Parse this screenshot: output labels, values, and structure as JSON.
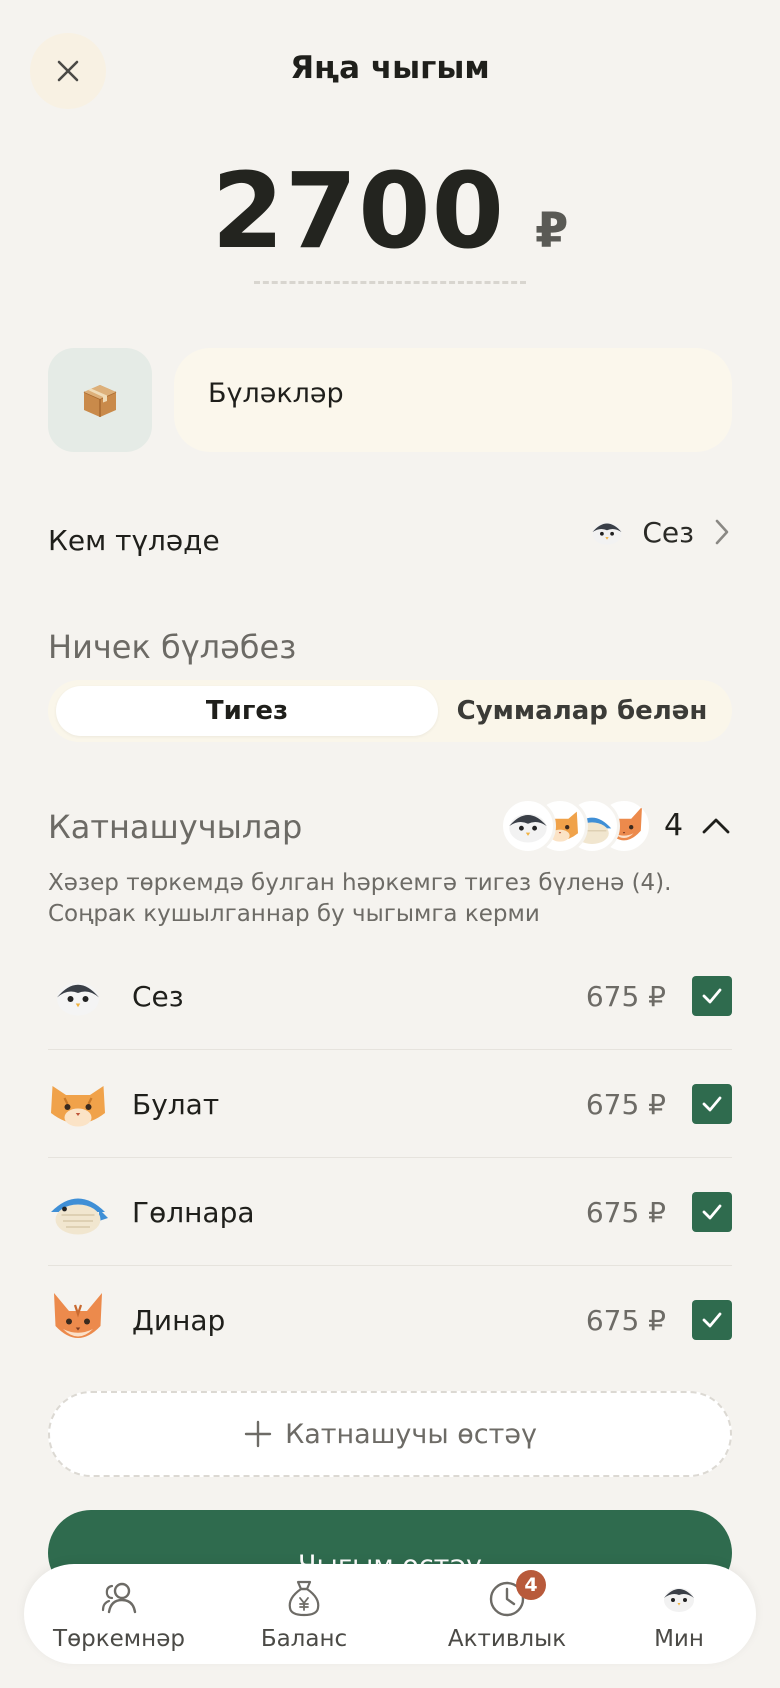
{
  "header": {
    "title": "Яңа чыгым"
  },
  "amount": {
    "value": "2700",
    "currency": "₽"
  },
  "category": {
    "name": "Бүләкләр",
    "icon": "package-icon"
  },
  "payer": {
    "label": "Кем түләде",
    "name": "Сез",
    "avatar": "penguin-avatar"
  },
  "split": {
    "title": "Ничек бүләбез",
    "options": [
      "Тигез",
      "Суммалар белән"
    ],
    "selected": "Тигез"
  },
  "participants": {
    "title": "Катнашучылар",
    "count": "4",
    "note": "Хәзер төркемдә булган һәркемгә тигез бүленә (4). Соңрак кушылганнар бу чыгымга керми",
    "items": [
      {
        "name": "Сез",
        "amount": "675 ₽",
        "avatar": "penguin-avatar",
        "checked": true
      },
      {
        "name": "Булат",
        "amount": "675 ₽",
        "avatar": "cat-avatar",
        "checked": true
      },
      {
        "name": "Гөлнара",
        "amount": "675 ₽",
        "avatar": "whale-avatar",
        "checked": true
      },
      {
        "name": "Динар",
        "amount": "675 ₽",
        "avatar": "fox-avatar",
        "checked": true
      }
    ],
    "add_label": "Катнашучы өстәү"
  },
  "primary_button": "Чыгым өстәү",
  "tabbar": {
    "items": [
      {
        "label": "Төркемнәр",
        "icon": "people-icon"
      },
      {
        "label": "Баланс",
        "icon": "money-bag-icon"
      },
      {
        "label": "Активлык",
        "icon": "clock-icon",
        "badge": "4"
      },
      {
        "label": "Мин",
        "icon": "penguin-avatar"
      }
    ]
  },
  "colors": {
    "accent": "#2f6b4e",
    "background": "#f5f3ef",
    "badge": "#b85a3b"
  }
}
